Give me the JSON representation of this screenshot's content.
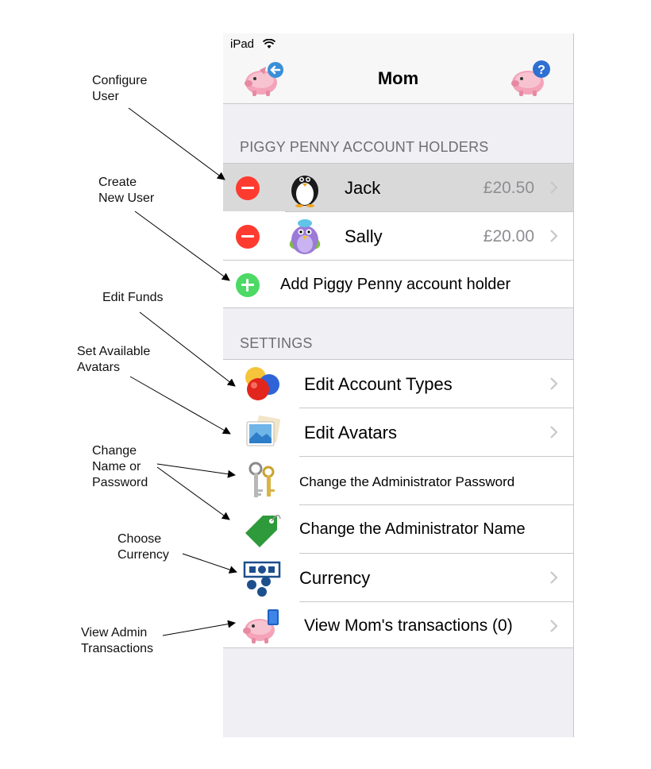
{
  "status_bar": {
    "carrier": "iPad",
    "wifi_icon": "wifi-icon"
  },
  "nav": {
    "title": "Mom",
    "left_button_icon": "piggy-back-icon",
    "right_button_icon": "piggy-help-icon"
  },
  "account_holders": {
    "header": "PIGGY PENNY ACCOUNT HOLDERS",
    "rows": [
      {
        "name": "Jack",
        "balance": "£20.50",
        "avatar": "penguin-avatar-icon",
        "selected": true
      },
      {
        "name": "Sally",
        "balance": "£20.00",
        "avatar": "bird-avatar-icon",
        "selected": false
      }
    ],
    "add_label": "Add Piggy Penny account holder"
  },
  "settings": {
    "header": "SETTINGS",
    "rows": [
      {
        "label": "Edit Account Types",
        "icon": "bubbles-icon",
        "chevron": true
      },
      {
        "label": "Edit Avatars",
        "icon": "photos-icon",
        "chevron": true
      },
      {
        "label": "Change the Administrator Password",
        "icon": "keys-icon",
        "chevron": false
      },
      {
        "label": "Change the Administrator Name",
        "icon": "tag-icon",
        "chevron": false
      },
      {
        "label": "Currency",
        "icon": "currency-icon",
        "chevron": true
      },
      {
        "label": "View Mom's transactions (0)",
        "icon": "piggy-book-icon",
        "chevron": true
      }
    ]
  },
  "annotations": {
    "configure_user": [
      "Configure",
      "User"
    ],
    "create_new_user": [
      "Create",
      "New User"
    ],
    "edit_funds": [
      "Edit Funds"
    ],
    "set_avatars": [
      "Set Available",
      "Avatars"
    ],
    "change_name": [
      "Change",
      "Name or",
      "Password"
    ],
    "choose_currency": [
      "Choose",
      "Currency"
    ],
    "view_admin": [
      "View Admin",
      "Transactions"
    ]
  },
  "colors": {
    "delete": "#ff3b30",
    "add": "#4cd964",
    "section_header": "#6d6d72",
    "secondary_text": "#8e8e93",
    "group_bg": "#efeff4"
  }
}
